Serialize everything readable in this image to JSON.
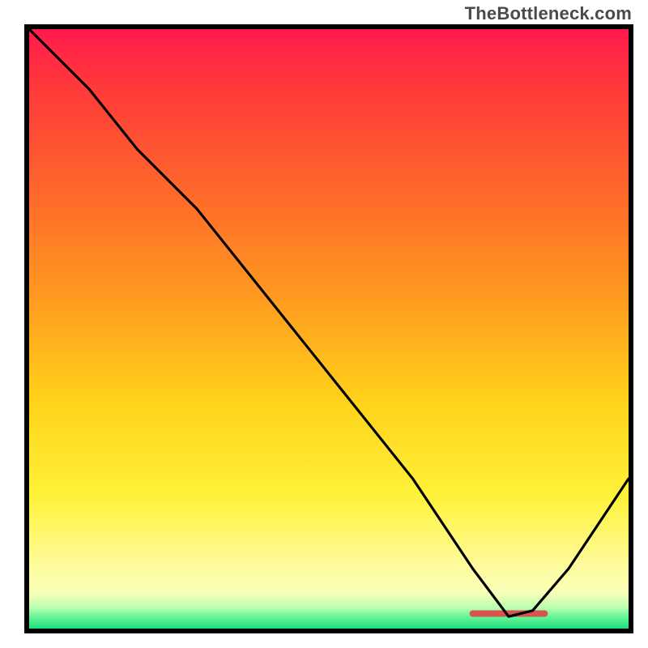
{
  "watermark": "TheBottleneck.com",
  "chart_data": {
    "type": "line",
    "title": "",
    "xlabel": "",
    "ylabel": "",
    "xlim": [
      0,
      100
    ],
    "ylim": [
      0,
      100
    ],
    "grid": false,
    "legend": false,
    "background_gradient": {
      "direction": "vertical",
      "stops": [
        {
          "pos": 0,
          "color": "#ff1a4d"
        },
        {
          "pos": 0.45,
          "color": "#ff9b1f"
        },
        {
          "pos": 0.78,
          "color": "#fff23a"
        },
        {
          "pos": 0.95,
          "color": "#f9ffb8"
        },
        {
          "pos": 1.0,
          "color": "#1be07a"
        }
      ]
    },
    "series": [
      {
        "name": "bottleneck-curve",
        "color": "#000000",
        "x": [
          0,
          10,
          18,
          28,
          40,
          52,
          64,
          74,
          80,
          84,
          90,
          100
        ],
        "y": [
          100,
          90,
          80,
          70,
          55,
          40,
          25,
          10,
          2,
          3,
          10,
          25
        ]
      },
      {
        "name": "optimal-range-marker",
        "color": "#d9534f",
        "x": [
          74,
          86
        ],
        "y": [
          2.5,
          2.5
        ]
      }
    ],
    "annotations": []
  }
}
